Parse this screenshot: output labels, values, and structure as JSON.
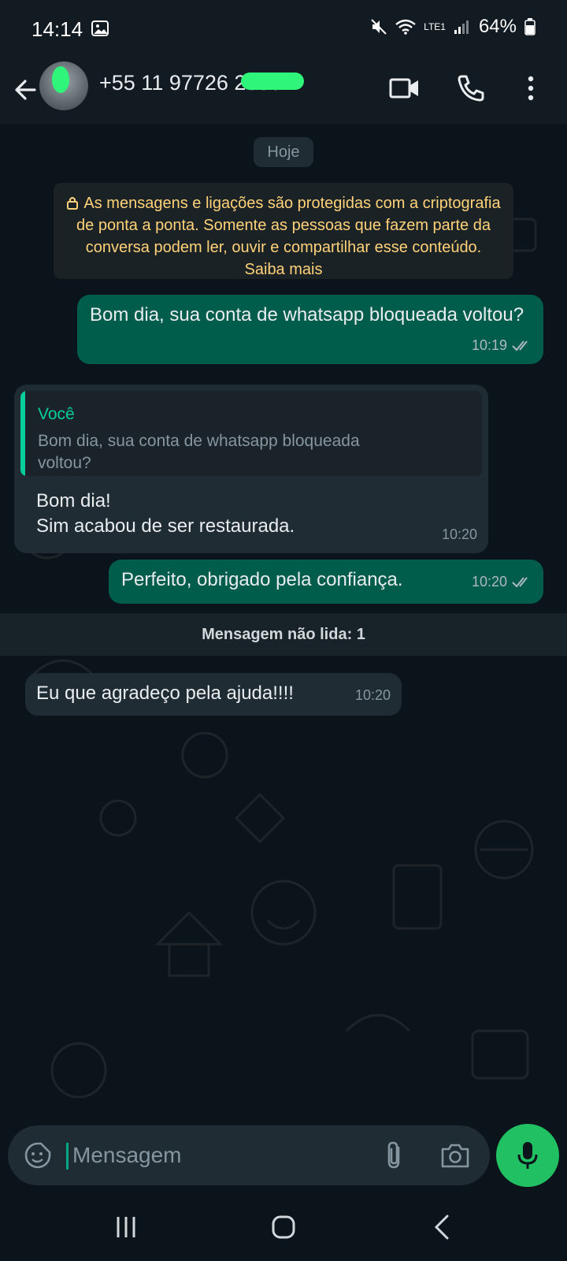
{
  "status": {
    "time": "14:14",
    "battery": "64%",
    "network": "LTE1"
  },
  "header": {
    "contact": "+55 11 97726 2000",
    "back_label": "back",
    "menu": "more-vert"
  },
  "chat": {
    "date": "Hoje",
    "encryption_notice": "As mensagens e ligações são protegidas com a criptografia de ponta a ponta. Somente as pessoas que fazem parte da conversa podem ler, ouvir e compartilhar esse conteúdo. Saiba mais",
    "messages": [
      {
        "text": "Bom dia, sua conta de whatsapp bloqueada voltou?",
        "time": "10:19",
        "direction": "out"
      },
      {
        "quote_author": "Você",
        "quote_text": "Bom dia, sua conta de whatsapp bloqueada voltou?",
        "text_line1": "Bom dia!",
        "text_line2": "Sim acabou de ser restaurada.",
        "time": "10:20",
        "direction": "in"
      },
      {
        "text": "Perfeito, obrigado pela confiança.",
        "time": "10:20",
        "direction": "out"
      },
      {
        "text": "Eu que agradeço pela ajuda!!!!",
        "time": "10:20",
        "direction": "in"
      }
    ],
    "unread_label": "Mensagem não lida: 1"
  },
  "composer": {
    "placeholder": "Mensagem"
  },
  "colors": {
    "accent": "#00a884",
    "outgoing": "#005c4b",
    "incoming": "#202c33",
    "mic": "#21c063"
  }
}
